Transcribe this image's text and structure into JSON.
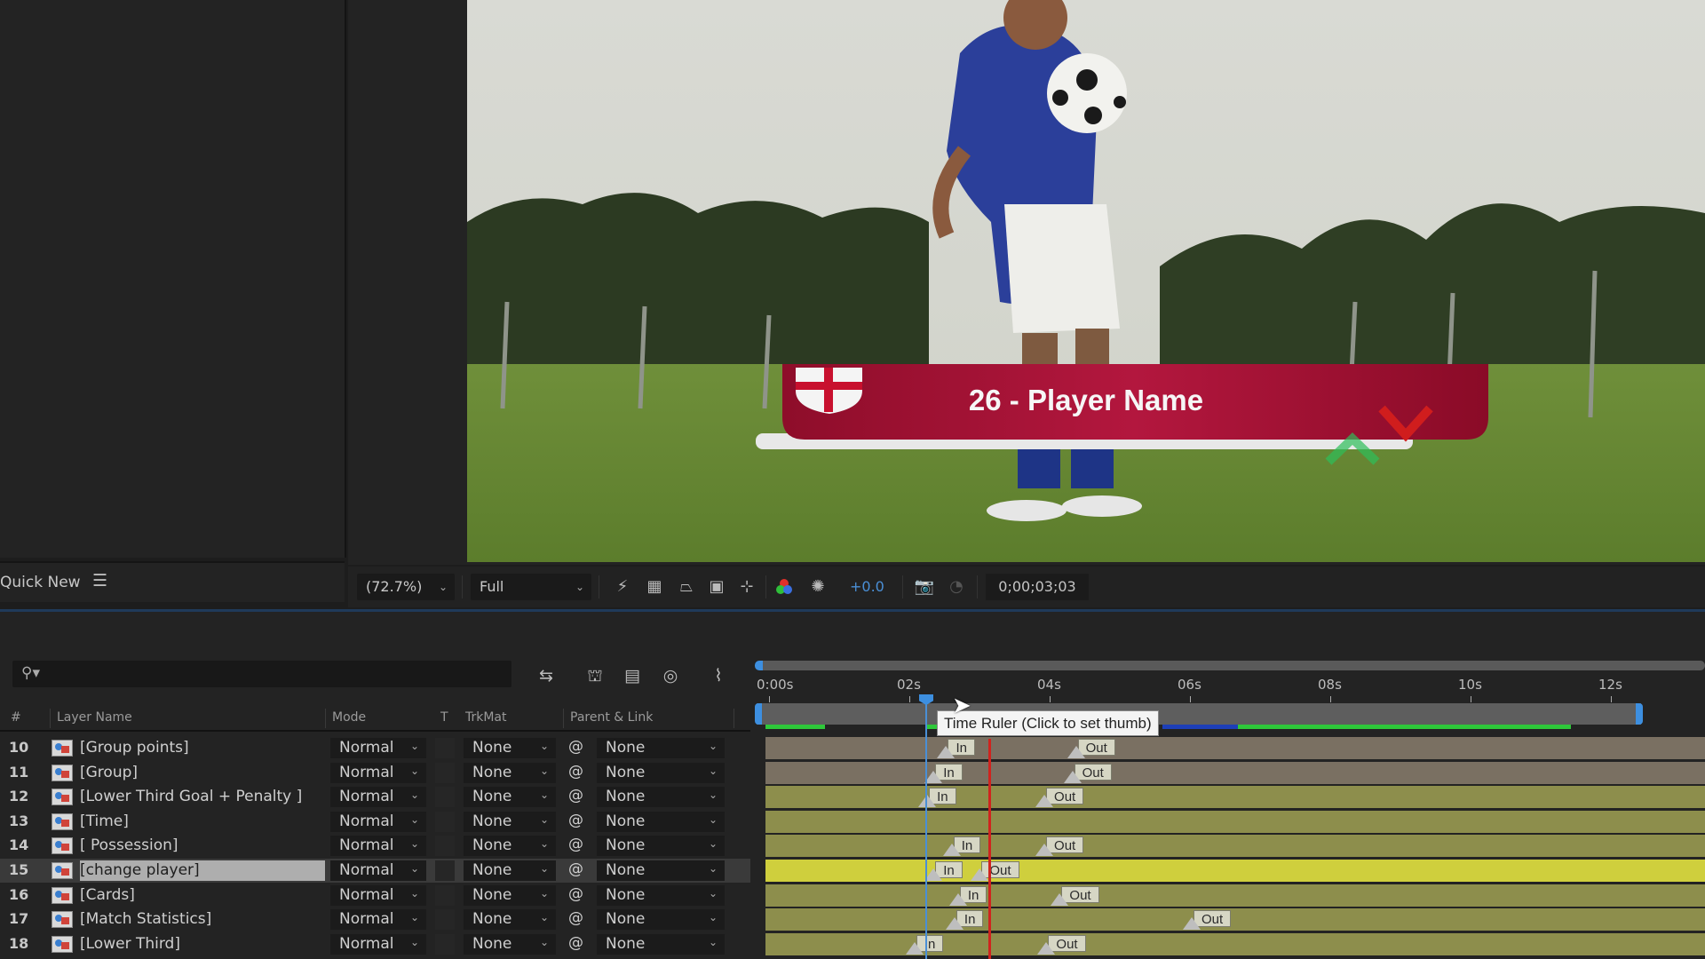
{
  "project_panel": {
    "quick_new_label": "Quick New",
    "menu_icon": "hamburger-icon"
  },
  "viewer": {
    "lower_third_text": "26 - Player Name",
    "toolbar": {
      "zoom_value": "(72.7%)",
      "resolution_value": "Full",
      "exposure_value": "+0.0",
      "timecode": "0;00;03;03",
      "icons": [
        "fast-previews-icon",
        "transparency-grid-icon",
        "mask-path-icon",
        "region-of-interest-icon",
        "target-region-icon",
        "channel-icon",
        "exposure-reset-icon",
        "snapshot-icon",
        "show-snapshot-icon"
      ]
    }
  },
  "timeline": {
    "search_placeholder": "",
    "switch_icons": [
      "composition-flowchart-icon",
      "draft-3d-icon",
      "frame-blending-icon",
      "motion-blur-icon",
      "graph-editor-icon"
    ],
    "columns": {
      "num": "#",
      "layer_name": "Layer Name",
      "mode": "Mode",
      "t": "T",
      "trkmat": "TrkMat",
      "parent": "Parent & Link"
    },
    "ruler": {
      "ticks": [
        "0:00s",
        "02s",
        "04s",
        "06s",
        "08s",
        "10s",
        "12s"
      ],
      "tooltip": "Time Ruler (Click to set thumb)"
    },
    "layers": [
      {
        "num": "10",
        "name": "[Group  points]",
        "mode": "Normal",
        "trkmat": "None",
        "parent": "None",
        "selected": false,
        "bar": "tan",
        "in": 2.55,
        "out": 4.4
      },
      {
        "num": "11",
        "name": "[Group]",
        "mode": "Normal",
        "trkmat": "None",
        "parent": "None",
        "selected": false,
        "bar": "tan",
        "in": 2.37,
        "out": 4.35
      },
      {
        "num": "12",
        "name": "[Lower Third Goal + Penalty ]",
        "mode": "Normal",
        "trkmat": "None",
        "parent": "None",
        "selected": false,
        "bar": "olive",
        "in": 2.28,
        "out": 3.95
      },
      {
        "num": "13",
        "name": "[Time]",
        "mode": "Normal",
        "trkmat": "None",
        "parent": "None",
        "selected": false,
        "bar": "olive",
        "in": null,
        "out": null
      },
      {
        "num": "14",
        "name": "[ Possession]",
        "mode": "Normal",
        "trkmat": "None",
        "parent": "None",
        "selected": false,
        "bar": "olive",
        "in": 2.63,
        "out": 3.95
      },
      {
        "num": "15",
        "name": "[change player]",
        "mode": "Normal",
        "trkmat": "None",
        "parent": "None",
        "selected": true,
        "bar": "yellow",
        "in": 2.37,
        "out": 3.03
      },
      {
        "num": "16",
        "name": "[Cards]",
        "mode": "Normal",
        "trkmat": "None",
        "parent": "None",
        "selected": false,
        "bar": "olive",
        "in": 2.72,
        "out": 4.17
      },
      {
        "num": "17",
        "name": "[Match Statistics]",
        "mode": "Normal",
        "trkmat": "None",
        "parent": "None",
        "selected": false,
        "bar": "olive",
        "in": 2.67,
        "out": 6.05
      },
      {
        "num": "18",
        "name": "[Lower Third]",
        "mode": "Normal",
        "trkmat": "None",
        "parent": "None",
        "selected": false,
        "bar": "olive",
        "in": 2.1,
        "out": 3.98
      }
    ],
    "colors": {
      "tan": "#7a7062",
      "olive": "#8d8e4c",
      "yellow": "#cfcf3d",
      "playhead": "#4a8fd6",
      "red_line": "#d0231e",
      "cache_green": "#2ec83a",
      "cache_blue": "#1d3fb8"
    }
  }
}
